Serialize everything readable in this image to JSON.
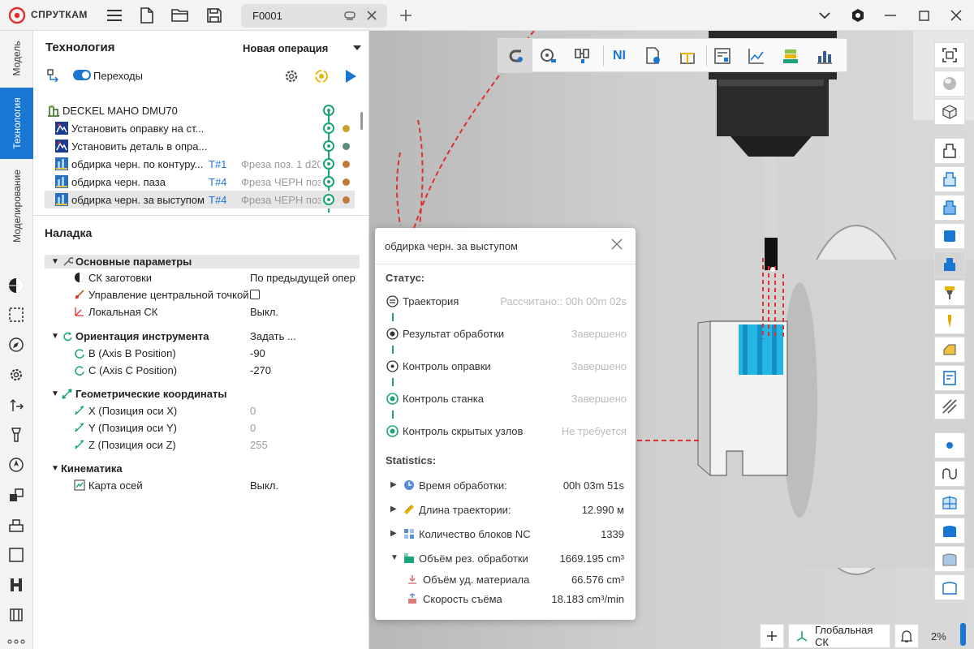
{
  "app": {
    "name": "СПРУТКАМ"
  },
  "tabs": [
    {
      "label": "F0001"
    }
  ],
  "vertical_tabs": [
    {
      "label": "Модель"
    },
    {
      "label": "Технология"
    },
    {
      "label": "Моделирование"
    }
  ],
  "tech": {
    "title": "Технология",
    "new_operation": "Новая операция",
    "transitions_label": "Переходы",
    "machine": "DECKEL MAHO DMU70",
    "operations": [
      {
        "label": "Установить оправку на ст...",
        "tool_no": "",
        "tool": "",
        "dot_color": "#c9a227"
      },
      {
        "label": "Установить деталь в опра...",
        "tool_no": "",
        "tool": "",
        "dot_color": "#5f8a7e"
      },
      {
        "label": "обдирка черн. по контуру...",
        "tool_no": "T#1",
        "tool": "Фреза поз. 1 d20",
        "dot_color": "#c07a3a"
      },
      {
        "label": "обдирка черн. паза",
        "tool_no": "T#4",
        "tool": "Фреза ЧЕРН поз",
        "dot_color": "#c07a3a"
      },
      {
        "label": "обдирка черн. за выступом",
        "tool_no": "T#4",
        "tool": "Фреза ЧЕРН поз",
        "dot_color": "#c07a3a"
      }
    ]
  },
  "setup": {
    "title": "Наладка",
    "groups": {
      "basic": {
        "label": "Основные параметры"
      },
      "orientation": {
        "label": "Ориентация инструмента",
        "value": "Задать ..."
      },
      "geometry": {
        "label": "Геометрические координаты"
      },
      "kinematics": {
        "label": "Кинематика"
      }
    },
    "props": {
      "cs_blank": {
        "label": "СК заготовки",
        "value": "По предыдущей опер"
      },
      "tcp": {
        "label": "Управление центральной точкой"
      },
      "local_cs": {
        "label": "Локальная СК",
        "value": "Выкл."
      },
      "b_axis": {
        "label": "B (Axis B Position)",
        "value": "-90"
      },
      "c_axis": {
        "label": "C (Axis C Position)",
        "value": "-270"
      },
      "x": {
        "label": "X (Позиция оси X)",
        "value": "0"
      },
      "y": {
        "label": "Y (Позиция оси Y)",
        "value": "0"
      },
      "z": {
        "label": "Z (Позиция оси Z)",
        "value": "255"
      },
      "axis_map": {
        "label": "Карта осей",
        "value": "Выкл."
      }
    }
  },
  "popup": {
    "title": "обдирка черн. за выступом",
    "status_title": "Статус:",
    "steps": [
      {
        "label": "Траектория",
        "value": "Рассчитано:: 00h 00m 02s"
      },
      {
        "label": "Результат обработки",
        "value": "Завершено"
      },
      {
        "label": "Контроль оправки",
        "value": "Завершено"
      },
      {
        "label": "Контроль станка",
        "value": "Завершено"
      },
      {
        "label": "Контроль скрытых узлов",
        "value": "Не требуется"
      }
    ],
    "stats_title": "Statistics:",
    "stats": [
      {
        "label": "Время обработки:",
        "value": "00h 03m 51s"
      },
      {
        "label": "Длина траектории:",
        "value": "12.990 м"
      },
      {
        "label": "Количество блоков NC",
        "value": "1339"
      },
      {
        "label": "Объём рез. обработки",
        "value": "1669.195 cm³"
      },
      {
        "label": "Объём уд. материала",
        "value": "66.576 cm³"
      },
      {
        "label": "Скорость съёма",
        "value": "18.183 cm³/min"
      }
    ]
  },
  "viewport": {
    "nc_button": "NI",
    "coord_system": "Глобальная СК",
    "zoom": "2%"
  },
  "colors": {
    "accent": "#1976d2",
    "status_green": "#1aa37a",
    "toolpath_red": "#e03030",
    "part_cyan": "#22b6e6"
  }
}
